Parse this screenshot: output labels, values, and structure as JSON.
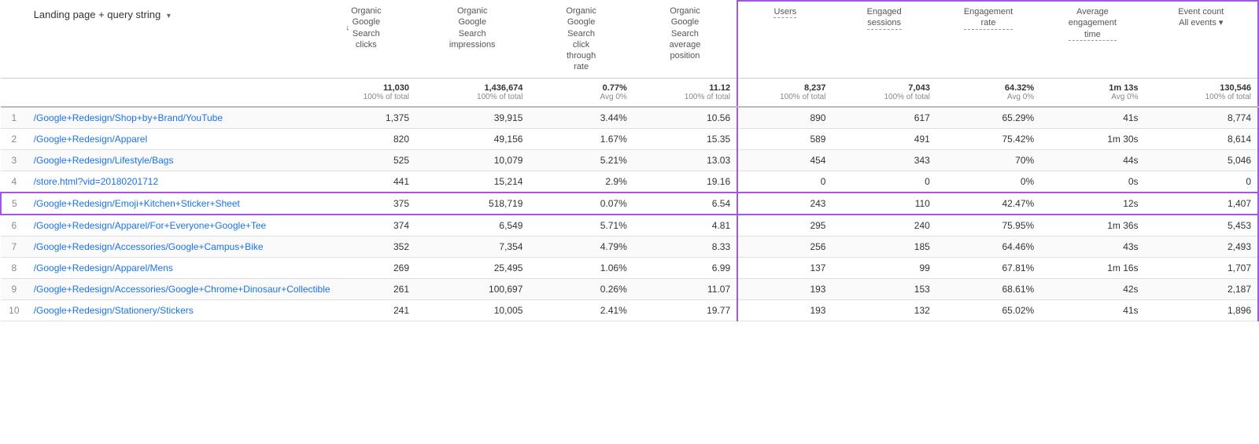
{
  "header": {
    "page_column_title": "Landing page + query string",
    "dropdown_icon": "▾",
    "add_icon": "+",
    "columns": {
      "clicks": {
        "label": "Organic\nGoogle\nSearch\nclicks",
        "lines": [
          "Organic",
          "Google",
          "Search",
          "clicks"
        ]
      },
      "impressions": {
        "label": "Organic\nGoogle\nSearch\nimpressions",
        "lines": [
          "Organic",
          "Google",
          "Search",
          "impressions"
        ]
      },
      "ctr": {
        "label": "Organic\nGoogle\nSearch\nclick\nthrough\nrate",
        "lines": [
          "Organic",
          "Google",
          "Search",
          "click",
          "through",
          "rate"
        ]
      },
      "position": {
        "label": "Organic\nGoogle\nSearch\naverage\nposition",
        "lines": [
          "Organic",
          "Google",
          "Search",
          "average",
          "position"
        ]
      },
      "users": {
        "label": "Users"
      },
      "engaged_sessions": {
        "label": "Engaged\nsessions",
        "lines": [
          "Engaged",
          "sessions"
        ]
      },
      "engagement_rate": {
        "label": "Engagement\nrate",
        "lines": [
          "Engagement",
          "rate"
        ]
      },
      "avg_engagement_time": {
        "label": "Average\nengagement\ntime",
        "lines": [
          "Average",
          "engagement",
          "time"
        ]
      },
      "event_count": {
        "label": "Event count",
        "all_events_label": "All events",
        "dropdown_icon": "▾"
      }
    }
  },
  "totals": {
    "clicks": "11,030",
    "clicks_sub": "100% of total",
    "impressions": "1,436,674",
    "impressions_sub": "100% of total",
    "ctr": "0.77%",
    "ctr_sub": "Avg 0%",
    "position": "11.12",
    "position_sub": "100% of total",
    "users": "8,237",
    "users_sub": "100% of total",
    "engaged_sessions": "7,043",
    "engaged_sessions_sub": "100% of total",
    "engagement_rate": "64.32%",
    "engagement_rate_sub": "Avg 0%",
    "avg_engagement_time": "1m 13s",
    "avg_engagement_time_sub": "Avg 0%",
    "event_count": "130,546",
    "event_count_sub": "100% of total"
  },
  "rows": [
    {
      "index": "1",
      "page": "/Google+Redesign/Shop+by+Brand/YouTube",
      "clicks": "1,375",
      "impressions": "39,915",
      "ctr": "3.44%",
      "position": "10.56",
      "users": "890",
      "engaged_sessions": "617",
      "engagement_rate": "65.29%",
      "avg_engagement_time": "41s",
      "event_count": "8,774"
    },
    {
      "index": "2",
      "page": "/Google+Redesign/Apparel",
      "clicks": "820",
      "impressions": "49,156",
      "ctr": "1.67%",
      "position": "15.35",
      "users": "589",
      "engaged_sessions": "491",
      "engagement_rate": "75.42%",
      "avg_engagement_time": "1m 30s",
      "event_count": "8,614"
    },
    {
      "index": "3",
      "page": "/Google+Redesign/Lifestyle/Bags",
      "clicks": "525",
      "impressions": "10,079",
      "ctr": "5.21%",
      "position": "13.03",
      "users": "454",
      "engaged_sessions": "343",
      "engagement_rate": "70%",
      "avg_engagement_time": "44s",
      "event_count": "5,046"
    },
    {
      "index": "4",
      "page": "/store.html?vid=20180201712",
      "clicks": "441",
      "impressions": "15,214",
      "ctr": "2.9%",
      "position": "19.16",
      "users": "0",
      "engaged_sessions": "0",
      "engagement_rate": "0%",
      "avg_engagement_time": "0s",
      "event_count": "0"
    },
    {
      "index": "5",
      "page": "/Google+Redesign/Emoji+Kitchen+Sticker+Sheet",
      "clicks": "375",
      "impressions": "518,719",
      "ctr": "0.07%",
      "position": "6.54",
      "users": "243",
      "engaged_sessions": "110",
      "engagement_rate": "42.47%",
      "avg_engagement_time": "12s",
      "event_count": "1,407",
      "highlighted": true
    },
    {
      "index": "6",
      "page": "/Google+Redesign/Apparel/For+Everyone+Google+Tee",
      "clicks": "374",
      "impressions": "6,549",
      "ctr": "5.71%",
      "position": "4.81",
      "users": "295",
      "engaged_sessions": "240",
      "engagement_rate": "75.95%",
      "avg_engagement_time": "1m 36s",
      "event_count": "5,453"
    },
    {
      "index": "7",
      "page": "/Google+Redesign/Accessories/Google+Campus+Bike",
      "clicks": "352",
      "impressions": "7,354",
      "ctr": "4.79%",
      "position": "8.33",
      "users": "256",
      "engaged_sessions": "185",
      "engagement_rate": "64.46%",
      "avg_engagement_time": "43s",
      "event_count": "2,493"
    },
    {
      "index": "8",
      "page": "/Google+Redesign/Apparel/Mens",
      "clicks": "269",
      "impressions": "25,495",
      "ctr": "1.06%",
      "position": "6.99",
      "users": "137",
      "engaged_sessions": "99",
      "engagement_rate": "67.81%",
      "avg_engagement_time": "1m 16s",
      "event_count": "1,707"
    },
    {
      "index": "9",
      "page": "/Google+Redesign/Accessories/Google+Chrome+Dinosaur+Collectible",
      "clicks": "261",
      "impressions": "100,697",
      "ctr": "0.26%",
      "position": "11.07",
      "users": "193",
      "engaged_sessions": "153",
      "engagement_rate": "68.61%",
      "avg_engagement_time": "42s",
      "event_count": "2,187"
    },
    {
      "index": "10",
      "page": "/Google+Redesign/Stationery/Stickers",
      "clicks": "241",
      "impressions": "10,005",
      "ctr": "2.41%",
      "position": "19.77",
      "users": "193",
      "engaged_sessions": "132",
      "engagement_rate": "65.02%",
      "avg_engagement_time": "41s",
      "event_count": "1,896"
    }
  ]
}
